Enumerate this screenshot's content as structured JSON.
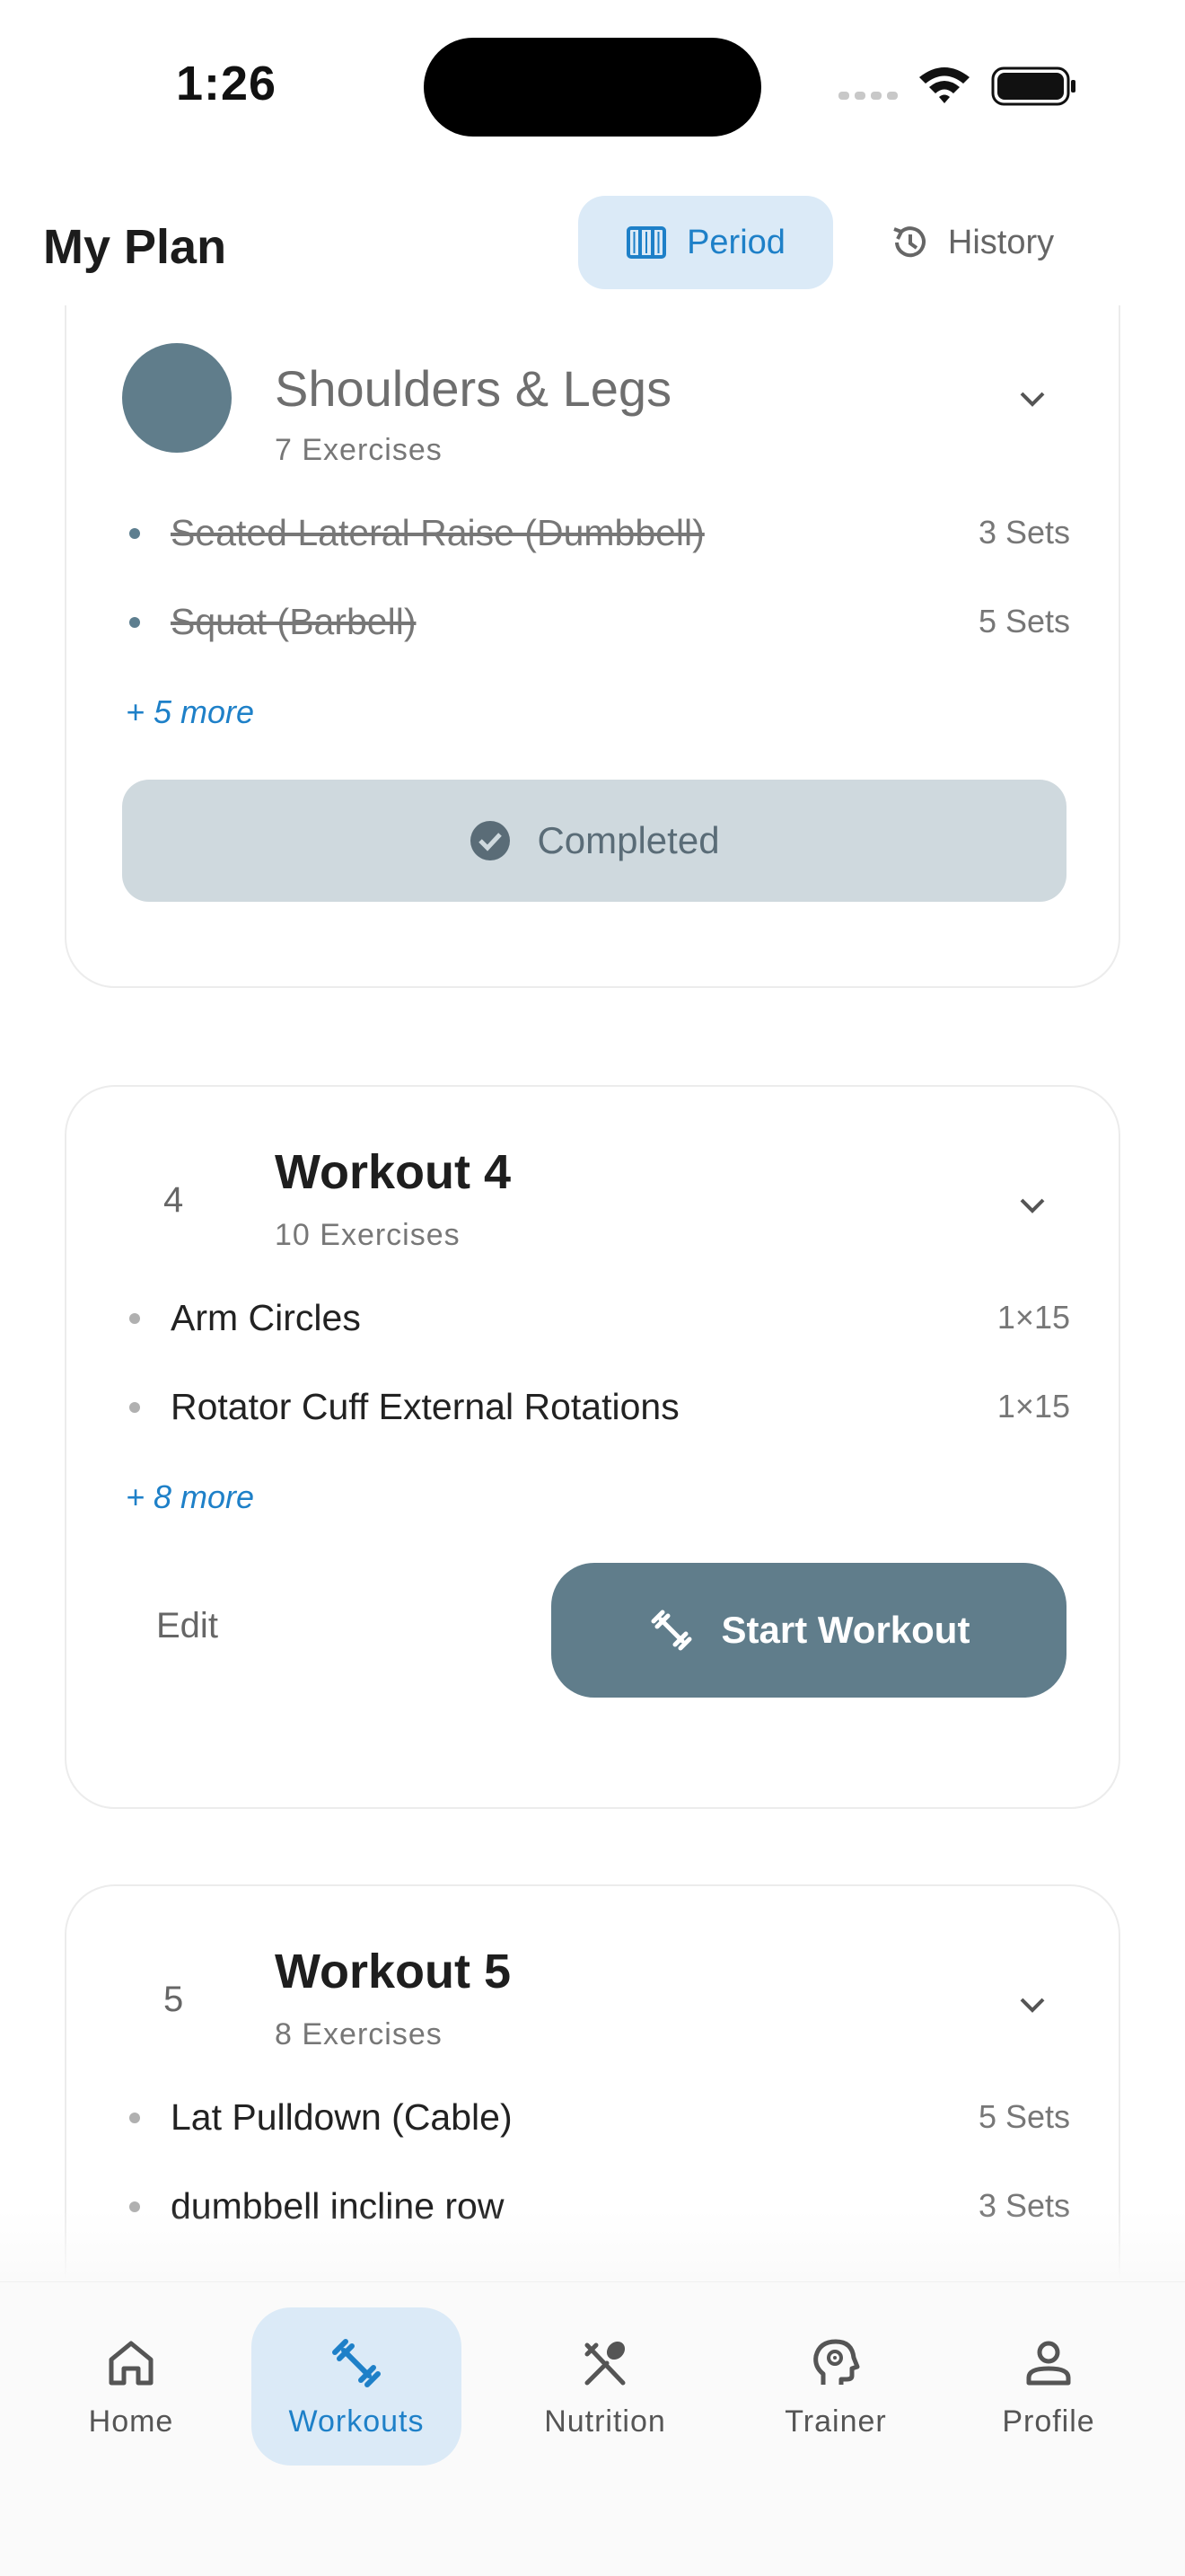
{
  "status_bar": {
    "time": "1:26"
  },
  "header": {
    "title": "My Plan",
    "segments": [
      {
        "label": "Period",
        "icon": "columns-icon",
        "active": true
      },
      {
        "label": "History",
        "icon": "history-icon",
        "active": false
      }
    ]
  },
  "cards": [
    {
      "title": "Shoulders & Legs",
      "subtitle": "7 Exercises",
      "status": "completed",
      "exercises": [
        {
          "name": "Seated Lateral Raise (Dumbbell)",
          "sets": "3 Sets",
          "done": true
        },
        {
          "name": "Squat (Barbell)",
          "sets": "5 Sets",
          "done": true
        }
      ],
      "more": "+ 5 more",
      "completed_label": "Completed"
    },
    {
      "number": "4",
      "title": "Workout 4",
      "subtitle": "10 Exercises",
      "exercises": [
        {
          "name": "Arm Circles",
          "sets": "1×15"
        },
        {
          "name": "Rotator Cuff External Rotations",
          "sets": "1×15"
        }
      ],
      "more": "+ 8 more",
      "edit_label": "Edit",
      "start_label": "Start Workout"
    },
    {
      "number": "5",
      "title": "Workout 5",
      "subtitle": "8 Exercises",
      "exercises": [
        {
          "name": "Lat Pulldown (Cable)",
          "sets": "5 Sets"
        },
        {
          "name": "dumbbell incline row",
          "sets": "3 Sets"
        }
      ]
    }
  ],
  "nav": {
    "items": [
      {
        "label": "Home",
        "icon": "home-icon"
      },
      {
        "label": "Workouts",
        "icon": "dumbbell-icon",
        "active": true
      },
      {
        "label": "Nutrition",
        "icon": "fork-spoon-icon"
      },
      {
        "label": "Trainer",
        "icon": "brain-head-icon"
      },
      {
        "label": "Profile",
        "icon": "person-icon"
      }
    ]
  },
  "colors": {
    "accent": "#1e80c8",
    "slate": "#607d8b",
    "accent_bg": "#dbeaf7",
    "completed_bg": "#cfd9de"
  }
}
